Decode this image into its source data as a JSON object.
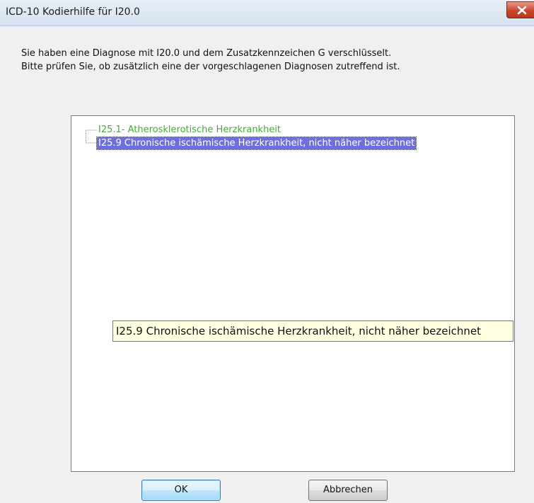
{
  "window": {
    "title": "ICD-10 Kodierhilfe für I20.0"
  },
  "message": {
    "line1": "Sie haben eine Diagnose mit I20.0 und dem Zusatzkennzeichen G verschlüsselt.",
    "line2": "Bitte prüfen Sie, ob zusätzlich eine der vorgeschlagenen Diagnosen zutreffend ist."
  },
  "tree": {
    "items": [
      {
        "label": "I25.1- Atherosklerotische Herzkrankheit",
        "selected": false,
        "color": "#46a83a"
      },
      {
        "label": "I25.9 Chronische ischämische Herzkrankheit, nicht näher bezeichnet",
        "selected": true,
        "color": "#ffffff"
      }
    ]
  },
  "tooltip": {
    "text": "I25.9 Chronische ischämische Herzkrankheit, nicht näher bezeichnet"
  },
  "buttons": {
    "ok_label": "OK",
    "cancel_label": "Abbrechen"
  },
  "colors": {
    "selection": "#6f6fd9",
    "tooltip_bg": "#ffffe1",
    "close_button": "#c9462c"
  }
}
